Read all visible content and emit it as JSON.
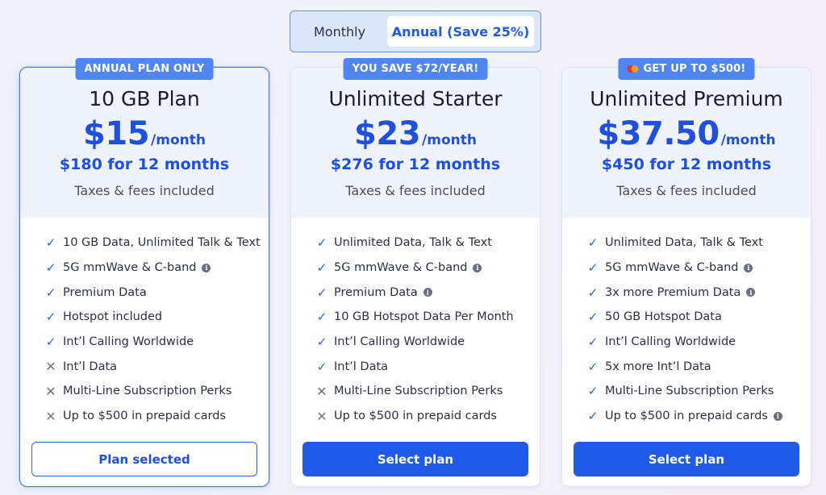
{
  "billing_toggle": {
    "monthly_label": "Monthly",
    "annual_label": "Annual (Save 25%)",
    "selected": "annual"
  },
  "plans": [
    {
      "badge": "ANNUAL PLAN ONLY",
      "name": "10 GB Plan",
      "price": "$15",
      "per": "/month",
      "total": "$180 for 12 months",
      "taxes": "Taxes & fees included",
      "features": [
        {
          "text": "10 GB Data, Unlimited Talk & Text",
          "included": true,
          "info": false
        },
        {
          "text": "5G mmWave & C-band",
          "included": true,
          "info": true
        },
        {
          "text": "Premium Data",
          "included": true,
          "info": false
        },
        {
          "text": "Hotspot included",
          "included": true,
          "info": false
        },
        {
          "text": "Int’l Calling Worldwide",
          "included": true,
          "info": false
        },
        {
          "text": "Int’l Data",
          "included": false,
          "info": false
        },
        {
          "text": "Multi-Line Subscription Perks",
          "included": false,
          "info": false
        },
        {
          "text": "Up to $500 in prepaid cards",
          "included": false,
          "info": false
        }
      ],
      "cta": "Plan selected"
    },
    {
      "badge": "YOU SAVE $72/YEAR!",
      "name": "Unlimited Starter",
      "price": "$23",
      "per": "/month",
      "total": "$276 for 12 months",
      "taxes": "Taxes & fees included",
      "features": [
        {
          "text": "Unlimited Data, Talk & Text",
          "included": true,
          "info": false
        },
        {
          "text": "5G mmWave & C-band",
          "included": true,
          "info": true
        },
        {
          "text": "Premium Data",
          "included": true,
          "info": true
        },
        {
          "text": "10 GB Hotspot Data Per Month",
          "included": true,
          "info": false
        },
        {
          "text": "Int’l Calling Worldwide",
          "included": true,
          "info": false
        },
        {
          "text": "Int’l Data",
          "included": true,
          "info": false
        },
        {
          "text": "Multi-Line Subscription Perks",
          "included": false,
          "info": false
        },
        {
          "text": "Up to $500 in prepaid cards",
          "included": false,
          "info": false
        }
      ],
      "cta": "Select plan"
    },
    {
      "badge": "GET UP TO $500!",
      "name": "Unlimited Premium",
      "price": "$37.50",
      "per": "/month",
      "total": "$450 for 12 months",
      "taxes": "Taxes & fees included",
      "features": [
        {
          "text": "Unlimited Data, Talk & Text",
          "included": true,
          "info": false
        },
        {
          "text": "5G mmWave & C-band",
          "included": true,
          "info": true
        },
        {
          "text": "3x more Premium Data",
          "included": true,
          "info": true
        },
        {
          "text": "50 GB Hotspot Data",
          "included": true,
          "info": false
        },
        {
          "text": "Int’l Calling Worldwide",
          "included": true,
          "info": false
        },
        {
          "text": "5x more Int’l Data",
          "included": true,
          "info": false
        },
        {
          "text": "Multi-Line Subscription Perks",
          "included": true,
          "info": false
        },
        {
          "text": "Up to $500 in prepaid cards",
          "included": true,
          "info": true
        }
      ],
      "cta": "Select plan"
    }
  ],
  "colors": {
    "accent": "#1f5bea",
    "badge": "#4f86f4",
    "card_header": "#eef3fd"
  },
  "icons": {
    "included": "check-icon",
    "excluded": "x-icon",
    "info": "info-icon",
    "badge_logo": "mastercard-logo-icon"
  }
}
